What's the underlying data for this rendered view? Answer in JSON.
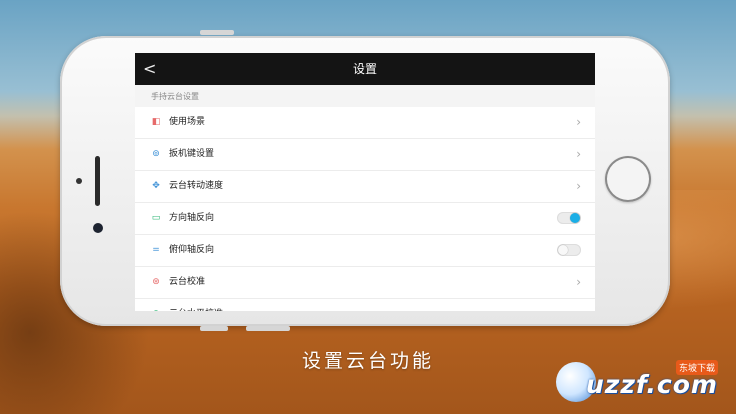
{
  "nav": {
    "back_glyph": "<",
    "title": "设置"
  },
  "section_title": "手持云台设置",
  "rows": [
    {
      "label": "使用场景",
      "icon": "scene-icon",
      "icon_color": "#e66a6a",
      "control": "chevron"
    },
    {
      "label": "扳机键设置",
      "icon": "trigger-icon",
      "icon_color": "#3a8fd6",
      "control": "chevron"
    },
    {
      "label": "云台转动速度",
      "icon": "rotate-speed-icon",
      "icon_color": "#3a8fd6",
      "control": "chevron"
    },
    {
      "label": "方向轴反向",
      "icon": "direction-axis-icon",
      "icon_color": "#2bb673",
      "control": "toggle",
      "on": true
    },
    {
      "label": "俯仰轴反向",
      "icon": "pitch-axis-icon",
      "icon_color": "#3a8fd6",
      "control": "toggle",
      "on": false
    },
    {
      "label": "云台校准",
      "icon": "calibrate-icon",
      "icon_color": "#e66a6a",
      "control": "chevron"
    },
    {
      "label": "云台水平校准",
      "icon": "level-calibrate-icon",
      "icon_color": "#2bb673",
      "control": "chevron"
    }
  ],
  "caption": "设置云台功能",
  "watermark": {
    "main": "uzzf.com",
    "sub": "东坡下载"
  },
  "colors": {
    "accent": "#1aaee6",
    "navbar": "#141414"
  }
}
